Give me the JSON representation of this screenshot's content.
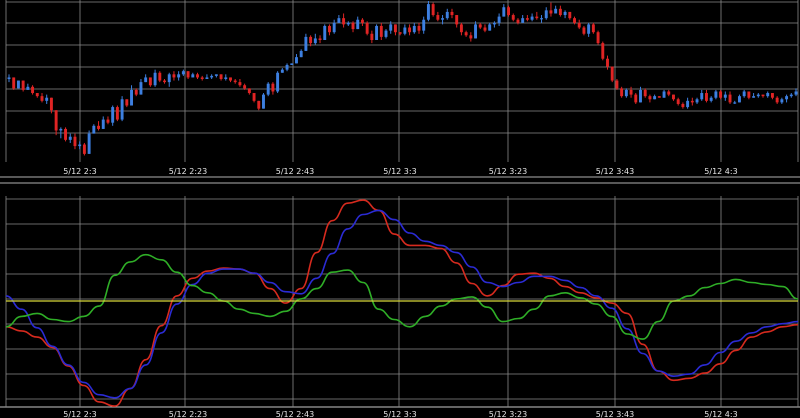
{
  "colors": {
    "background": "#000000",
    "grid": "#8a8a8a",
    "panel_border": "#c8c8c8",
    "separator": "#b0b0b0",
    "candle_up": "#3d7fe0",
    "candle_down": "#e02424",
    "line_red": "#d62a1e",
    "line_blue": "#2b2bd4",
    "line_green": "#2fae27",
    "line_yellow": "#d8d83a",
    "tick_text": "#e6e6e6"
  },
  "chart_data": [
    {
      "type": "candlestick",
      "x_tick_labels": [
        "5/12 2:3",
        "5/12 2:23",
        "5/12 2:43",
        "5/12 3:3",
        "5/12 3:23",
        "5/12 3:43",
        "5/12 4:3"
      ],
      "grid": true,
      "candles": [
        [
          50,
          53,
          48,
          51
        ],
        [
          51,
          51,
          43,
          44
        ],
        [
          44,
          49,
          44,
          49
        ],
        [
          49,
          49,
          42,
          43
        ],
        [
          43,
          47,
          43,
          45
        ],
        [
          45,
          46,
          40,
          41
        ],
        [
          41,
          41,
          38,
          39
        ],
        [
          39,
          41,
          35,
          36
        ],
        [
          36,
          40,
          34,
          38
        ],
        [
          38,
          38,
          28,
          30
        ],
        [
          30,
          30,
          14,
          17
        ],
        [
          17,
          19,
          12,
          18
        ],
        [
          18,
          19,
          10,
          11
        ],
        [
          11,
          15,
          9,
          13
        ],
        [
          13,
          15,
          5,
          7
        ],
        [
          7,
          10,
          5,
          8
        ],
        [
          8,
          9,
          1,
          2
        ],
        [
          2,
          17,
          2,
          15
        ],
        [
          15,
          21,
          15,
          20
        ],
        [
          20,
          23,
          17,
          18
        ],
        [
          18,
          26,
          18,
          24
        ],
        [
          24,
          26,
          21,
          22
        ],
        [
          22,
          33,
          20,
          32
        ],
        [
          32,
          33,
          23,
          24
        ],
        [
          24,
          39,
          23,
          37
        ],
        [
          37,
          37,
          32,
          33
        ],
        [
          33,
          46,
          33,
          43
        ],
        [
          43,
          44,
          39,
          40
        ],
        [
          40,
          50,
          40,
          48
        ],
        [
          48,
          53,
          48,
          51
        ],
        [
          51,
          51,
          45,
          46
        ],
        [
          46,
          56,
          45,
          54
        ],
        [
          54,
          55,
          48,
          49
        ],
        [
          49,
          50,
          47,
          48
        ],
        [
          48,
          54,
          45,
          53
        ],
        [
          53,
          55,
          49,
          51
        ],
        [
          51,
          55,
          49,
          53
        ],
        [
          53,
          56,
          52,
          55
        ],
        [
          55,
          55,
          50,
          51
        ],
        [
          51,
          54,
          51,
          53
        ],
        [
          53,
          54,
          50,
          51
        ],
        [
          51,
          52,
          49,
          50
        ],
        [
          50,
          53,
          50,
          51
        ],
        [
          51,
          53,
          50,
          52
        ],
        [
          52,
          53,
          51,
          53
        ],
        [
          53,
          53,
          49,
          50
        ],
        [
          50,
          53,
          49,
          51
        ],
        [
          51,
          51,
          48,
          49
        ],
        [
          49,
          50,
          47,
          48
        ],
        [
          48,
          50,
          45,
          46
        ],
        [
          46,
          47,
          43,
          44
        ],
        [
          44,
          44,
          40,
          41
        ],
        [
          41,
          41,
          35,
          36
        ],
        [
          36,
          36,
          30,
          31
        ],
        [
          31,
          41,
          31,
          40
        ],
        [
          40,
          48,
          39,
          47
        ],
        [
          47,
          48,
          40,
          42
        ],
        [
          42,
          55,
          41,
          54
        ],
        [
          54,
          57,
          54,
          56
        ],
        [
          56,
          60,
          55,
          59
        ],
        [
          59,
          60,
          59,
          60
        ],
        [
          60,
          66,
          60,
          64
        ],
        [
          64,
          69,
          64,
          68
        ],
        [
          68,
          79,
          68,
          77
        ],
        [
          77,
          78,
          71,
          73
        ],
        [
          73,
          79,
          72,
          76
        ],
        [
          76,
          78,
          73,
          75
        ],
        [
          75,
          85,
          75,
          84
        ],
        [
          84,
          85,
          78,
          80
        ],
        [
          80,
          88,
          79,
          86
        ],
        [
          86,
          91,
          86,
          89
        ],
        [
          89,
          92,
          83,
          85
        ],
        [
          85,
          87,
          84,
          86
        ],
        [
          86,
          87,
          80,
          82
        ],
        [
          82,
          90,
          82,
          88
        ],
        [
          88,
          89,
          84,
          86
        ],
        [
          86,
          87,
          78,
          79
        ],
        [
          79,
          81,
          73,
          75
        ],
        [
          75,
          85,
          75,
          84
        ],
        [
          84,
          86,
          75,
          77
        ],
        [
          77,
          82,
          76,
          81
        ],
        [
          81,
          87,
          79,
          85
        ],
        [
          85,
          85,
          78,
          80
        ],
        [
          80,
          80,
          78,
          79
        ],
        [
          79,
          85,
          78,
          83
        ],
        [
          83,
          85,
          78,
          80
        ],
        [
          80,
          86,
          79,
          84
        ],
        [
          84,
          86,
          79,
          81
        ],
        [
          81,
          90,
          79,
          88
        ],
        [
          88,
          100,
          87,
          98
        ],
        [
          98,
          99,
          90,
          91
        ],
        [
          91,
          93,
          87,
          88
        ],
        [
          88,
          91,
          85,
          89
        ],
        [
          89,
          95,
          88,
          93
        ],
        [
          93,
          95,
          89,
          91
        ],
        [
          91,
          91,
          83,
          85
        ],
        [
          85,
          86,
          78,
          80
        ],
        [
          80,
          81,
          77,
          78
        ],
        [
          78,
          80,
          74,
          76
        ],
        [
          76,
          87,
          76,
          85
        ],
        [
          85,
          86,
          82,
          83
        ],
        [
          83,
          85,
          80,
          81
        ],
        [
          81,
          86,
          81,
          85
        ],
        [
          85,
          87,
          83,
          86
        ],
        [
          86,
          92,
          84,
          90
        ],
        [
          90,
          98,
          90,
          96
        ],
        [
          96,
          97,
          90,
          91
        ],
        [
          91,
          92,
          87,
          88
        ],
        [
          88,
          89,
          85,
          86
        ],
        [
          86,
          91,
          86,
          89
        ],
        [
          89,
          91,
          87,
          88
        ],
        [
          88,
          92,
          87,
          90
        ],
        [
          90,
          93,
          88,
          89
        ],
        [
          89,
          91,
          86,
          89
        ],
        [
          89,
          96,
          88,
          94
        ],
        [
          94,
          99,
          90,
          92
        ],
        [
          92,
          97,
          92,
          95
        ],
        [
          95,
          97,
          90,
          91
        ],
        [
          91,
          94,
          89,
          93
        ],
        [
          93,
          93,
          88,
          89
        ],
        [
          89,
          90,
          85,
          86
        ],
        [
          86,
          88,
          82,
          83
        ],
        [
          83,
          84,
          78,
          79
        ],
        [
          79,
          86,
          77,
          85
        ],
        [
          85,
          86,
          79,
          80
        ],
        [
          80,
          81,
          72,
          73
        ],
        [
          73,
          74,
          62,
          63
        ],
        [
          63,
          65,
          56,
          58
        ],
        [
          58,
          58,
          48,
          49
        ],
        [
          49,
          50,
          43,
          44
        ],
        [
          44,
          45,
          38,
          39
        ],
        [
          39,
          44,
          38,
          43
        ],
        [
          43,
          45,
          38,
          40
        ],
        [
          40,
          41,
          34,
          35
        ],
        [
          35,
          45,
          35,
          43
        ],
        [
          43,
          44,
          38,
          39
        ],
        [
          39,
          40,
          35,
          37
        ],
        [
          37,
          40,
          37,
          39
        ],
        [
          39,
          39,
          38,
          38
        ],
        [
          38,
          43,
          38,
          42
        ],
        [
          42,
          43,
          39,
          40
        ],
        [
          40,
          40,
          36,
          37
        ],
        [
          37,
          38,
          33,
          34
        ],
        [
          34,
          35,
          31,
          32
        ],
        [
          32,
          38,
          31,
          36
        ],
        [
          36,
          38,
          33,
          35
        ],
        [
          35,
          38,
          34,
          37
        ],
        [
          37,
          43,
          36,
          41
        ],
        [
          41,
          43,
          35,
          36
        ],
        [
          36,
          39,
          35,
          38
        ],
        [
          38,
          43,
          37,
          42
        ],
        [
          42,
          43,
          37,
          38
        ],
        [
          38,
          42,
          36,
          40
        ],
        [
          40,
          42,
          34,
          35
        ],
        [
          35,
          36,
          34,
          35
        ],
        [
          35,
          40,
          35,
          39
        ],
        [
          39,
          43,
          38,
          42
        ],
        [
          42,
          42,
          37,
          38
        ],
        [
          38,
          41,
          38,
          39
        ],
        [
          39,
          41,
          38,
          40
        ],
        [
          40,
          40,
          38,
          39
        ],
        [
          39,
          42,
          38,
          41
        ],
        [
          41,
          41,
          37,
          38
        ],
        [
          38,
          39,
          34,
          35
        ],
        [
          35,
          38,
          34,
          37
        ],
        [
          37,
          40,
          35,
          39
        ],
        [
          39,
          41,
          38,
          40
        ],
        [
          40,
          44,
          39,
          42
        ]
      ]
    },
    {
      "type": "line",
      "x_tick_labels": [
        "5/12 2:3",
        "5/12 2:23",
        "5/12 2:43",
        "5/12 3:3",
        "5/12 3:23",
        "5/12 3:43",
        "5/12 4:3"
      ],
      "grid": true,
      "series": [
        {
          "color": "#d62a1e",
          "values": [
            -0.25,
            -0.29,
            -0.35,
            -0.45,
            -0.63,
            -0.82,
            -0.98,
            -1.02,
            -0.85,
            -0.57,
            -0.24,
            0.05,
            0.22,
            0.29,
            0.32,
            0.31,
            0.27,
            0.12,
            -0.02,
            0.12,
            0.47,
            0.78,
            0.95,
            0.98,
            0.88,
            0.65,
            0.54,
            0.54,
            0.51,
            0.37,
            0.17,
            0.05,
            0.15,
            0.26,
            0.27,
            0.22,
            0.14,
            0.08,
            0.03,
            -0.02,
            -0.12,
            -0.42,
            -0.68,
            -0.77,
            -0.75,
            -0.7,
            -0.61,
            -0.48,
            -0.35,
            -0.3,
            -0.25,
            -0.23
          ]
        },
        {
          "color": "#2b2bd4",
          "values": [
            0.05,
            -0.08,
            -0.26,
            -0.44,
            -0.62,
            -0.79,
            -0.91,
            -0.94,
            -0.85,
            -0.62,
            -0.31,
            -0.03,
            0.16,
            0.27,
            0.31,
            0.31,
            0.27,
            0.18,
            0.09,
            0.07,
            0.22,
            0.46,
            0.7,
            0.84,
            0.88,
            0.79,
            0.66,
            0.58,
            0.54,
            0.47,
            0.33,
            0.18,
            0.14,
            0.18,
            0.24,
            0.24,
            0.2,
            0.13,
            0.05,
            -0.07,
            -0.27,
            -0.51,
            -0.68,
            -0.73,
            -0.71,
            -0.62,
            -0.5,
            -0.39,
            -0.31,
            -0.25,
            -0.22,
            -0.2
          ]
        },
        {
          "color": "#2fae27",
          "values": [
            -0.25,
            -0.15,
            -0.12,
            -0.18,
            -0.2,
            -0.15,
            -0.05,
            0.25,
            0.38,
            0.45,
            0.4,
            0.28,
            0.15,
            0.08,
            0.0,
            -0.08,
            -0.12,
            -0.15,
            -0.1,
            0.02,
            0.12,
            0.28,
            0.3,
            0.18,
            -0.08,
            -0.18,
            -0.25,
            -0.15,
            -0.05,
            0.02,
            0.04,
            -0.06,
            -0.2,
            -0.17,
            -0.08,
            0.05,
            0.08,
            0.03,
            -0.03,
            -0.15,
            -0.32,
            -0.37,
            -0.2,
            0.0,
            0.05,
            0.13,
            0.17,
            0.21,
            0.18,
            0.16,
            0.14,
            0.02
          ]
        },
        {
          "color": "#d8d83a",
          "values": [
            0,
            0
          ]
        }
      ]
    }
  ]
}
